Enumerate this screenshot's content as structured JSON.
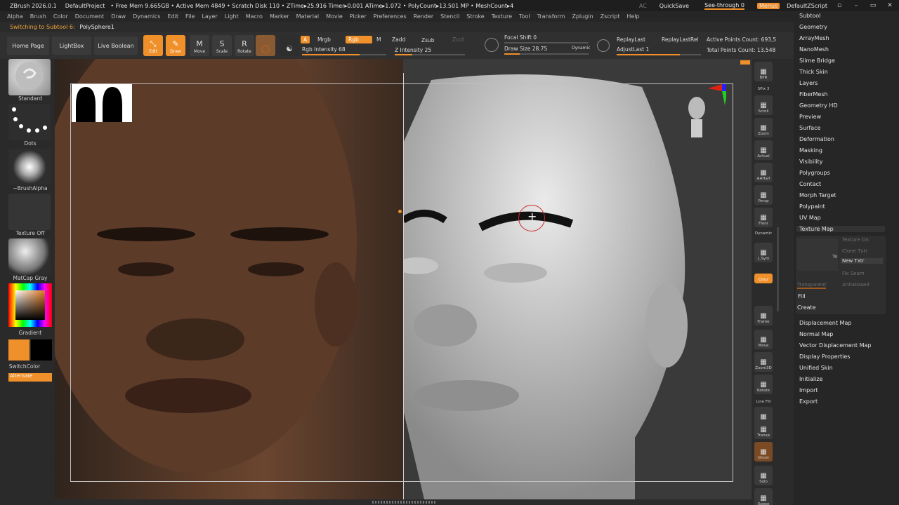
{
  "app": {
    "title": "ZBrush 2026.0.1",
    "project": "DefaultProject",
    "stats": "• Free Mem 9.665GB • Active Mem 4849 • Scratch Disk 110 • ZTime▸25.916 Timer▸0.001 ATime▸1.072 • PolyCount▸13.501 MP • MeshCount▸4",
    "ac": "AC",
    "quicksave": "QuickSave",
    "see_through": "See-through  0",
    "menus": "Menus",
    "script": "DefaultZScript"
  },
  "menubar": [
    "Alpha",
    "Brush",
    "Color",
    "Document",
    "Draw",
    "Dynamics",
    "Edit",
    "File",
    "Layer",
    "Light",
    "Macro",
    "Marker",
    "Material",
    "Movie",
    "Picker",
    "Preferences",
    "Render",
    "Stencil",
    "Stroke",
    "Texture",
    "Tool",
    "Transform",
    "Zplugin",
    "Zscript",
    "Help"
  ],
  "notice": {
    "label": "Switching to Subtool 6:",
    "value": "PolySphere1"
  },
  "toolbar": {
    "home": "Home Page",
    "lightbox": "LightBox",
    "live_boolean": "Live Boolean",
    "edit": "Edit",
    "draw": "Draw",
    "move": "Move",
    "scale": "Scale",
    "rotate": "Rotate",
    "a": "A",
    "mrgb": "Mrgb",
    "rgb": "Rgb",
    "m": "M",
    "zadd": "Zadd",
    "zsub": "Zsub",
    "zcut": "Zcut",
    "rgb_intensity": "Rgb Intensity 68",
    "z_intensity": "Z Intensity 25",
    "focal_shift": "Focal Shift 0",
    "draw_size": "Draw Size 28.75",
    "dynamic": "Dynamic",
    "replay_last": "ReplayLast",
    "replay_last_rel": "ReplayLastRel",
    "adjust_last": "AdjustLast  1",
    "active_points": "Active Points Count: 693,5",
    "total_points": "Total Points Count: 13.548",
    "rgb_intensity_level": 0.68,
    "z_intensity_level": 0.25
  },
  "leftshelf": {
    "standard": "Standard",
    "dots": "Dots",
    "brush_alpha": "~BrushAlpha",
    "texture_off": "Texture Off",
    "matcap": "MatCap Gray",
    "gradient": "Gradient",
    "switch_color": "SwitchColor",
    "alternate": "Alternate"
  },
  "rightshelf": [
    {
      "id": "bpr",
      "label": "BPR"
    },
    {
      "id": "spix",
      "label": "SPix 3"
    },
    {
      "id": "scroll",
      "label": "Scroll"
    },
    {
      "id": "zoom",
      "label": "Zoom"
    },
    {
      "id": "actual",
      "label": "Actual"
    },
    {
      "id": "aahalf",
      "label": "AAHalf"
    },
    {
      "id": "persp",
      "label": "Persp"
    },
    {
      "id": "floor",
      "label": "Floor"
    },
    {
      "id": "dynamic",
      "label": "Dynamic"
    },
    {
      "id": "lsym",
      "label": "L.Sym"
    },
    {
      "id": "xyz",
      "label": "Qxyz"
    },
    {
      "id": "frame",
      "label": "Frame"
    },
    {
      "id": "move",
      "label": "Move"
    },
    {
      "id": "zoom3d",
      "label": "Zoom3D"
    },
    {
      "id": "rotate",
      "label": "Rotate"
    },
    {
      "id": "linefill",
      "label": "Line Fill"
    },
    {
      "id": "polyf",
      "label": "PolyF"
    },
    {
      "id": "transp",
      "label": "Transp"
    },
    {
      "id": "ghost",
      "label": "Ghost"
    },
    {
      "id": "solo",
      "label": "Solo"
    },
    {
      "id": "xpose",
      "label": "Xpose"
    }
  ],
  "palette": {
    "items_top": [
      "Subtool",
      "Geometry",
      "ArrayMesh",
      "NanoMesh",
      "Slime Bridge",
      "Thick Skin",
      "Layers",
      "FiberMesh",
      "Geometry HD",
      "Preview",
      "Surface",
      "Deformation",
      "Masking",
      "Visibility",
      "Polygroups",
      "Contact",
      "Morph Target",
      "Polypaint",
      "UV Map",
      "Texture Map"
    ],
    "texture_sub": {
      "texture_on": "Texture On",
      "clone_txtr": "Clone Txtr",
      "new_txtr": "New Txtr",
      "fix_seam": "Fix Seam",
      "transparent": "Transparent",
      "antialiased": "Antialiased",
      "fill": "Fill",
      "create": "Create",
      "te": "Te"
    },
    "items_bottom": [
      "Displacement Map",
      "Normal Map",
      "Vector Displacement Map",
      "Display Properties",
      "Unified Skin",
      "Initialize",
      "Import",
      "Export"
    ]
  },
  "colors": {
    "accent": "#f0902a",
    "bg": "#2b2b2b"
  }
}
